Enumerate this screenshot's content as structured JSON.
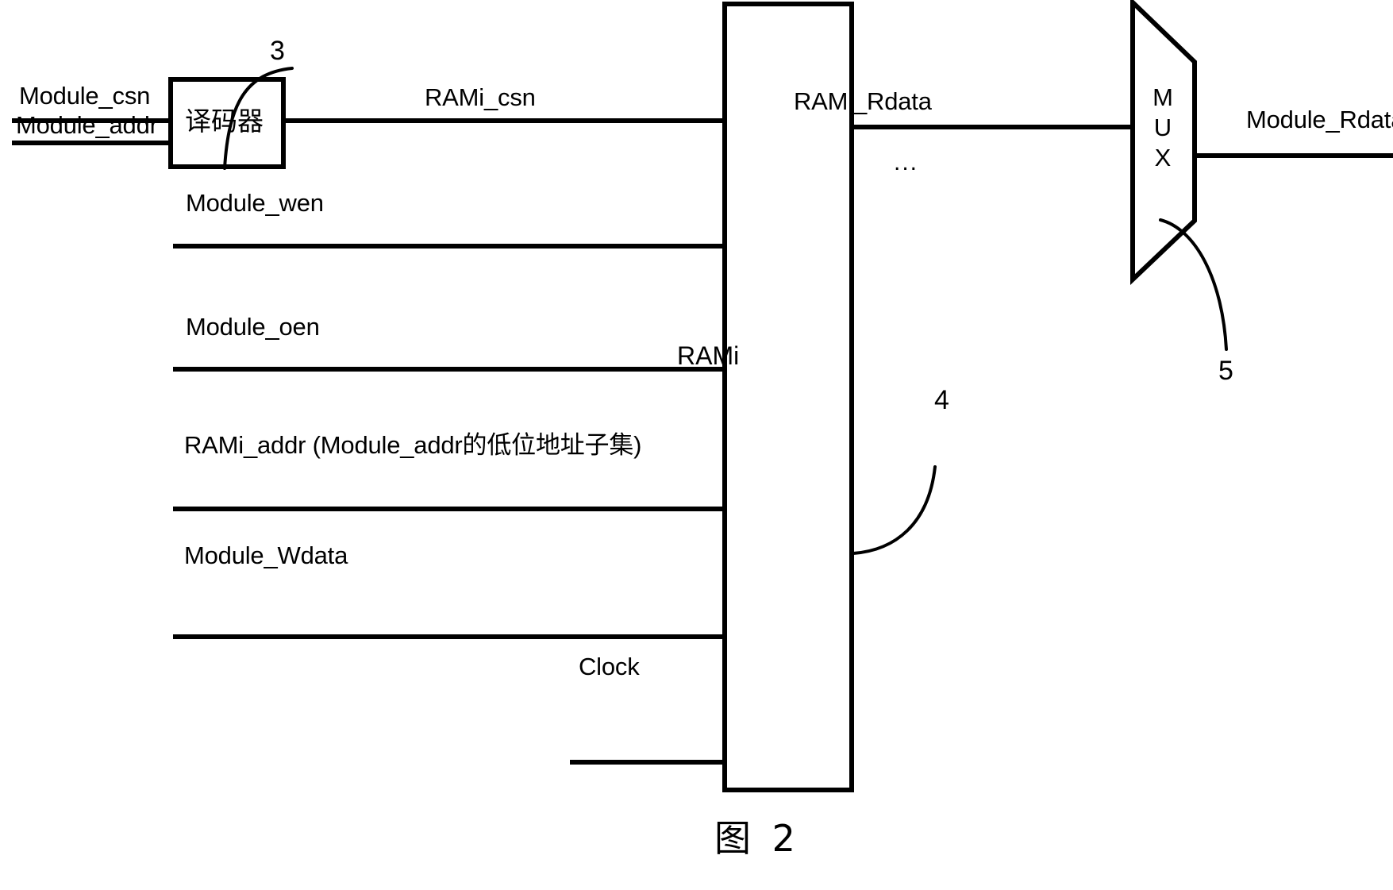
{
  "figure": {
    "caption": "图 2",
    "caption_label": "图",
    "caption_number": "2"
  },
  "blocks": {
    "decoder": {
      "label": "译码器",
      "ref": "3"
    },
    "ram": {
      "label": "RAMi",
      "ref": "4"
    },
    "mux": {
      "label": "MUX",
      "label_lines": [
        "M",
        "U",
        "X"
      ],
      "ref": "5"
    }
  },
  "signals": {
    "module_csn": "Module_csn",
    "module_addr": "Module_addr",
    "rami_csn": "RAMi_csn",
    "module_wen": "Module_wen",
    "module_oen": "Module_oen",
    "rami_addr": "RAMi_addr (Module_addr的低位地址子集)",
    "module_wdata": "Module_Wdata",
    "clock": "Clock",
    "rami_rdata": "RAMi_Rdata",
    "module_rdata": "Module_Rdata",
    "continuation": "..."
  },
  "colors": {
    "stroke": "#000000",
    "background": "#ffffff",
    "text": "#000000"
  }
}
